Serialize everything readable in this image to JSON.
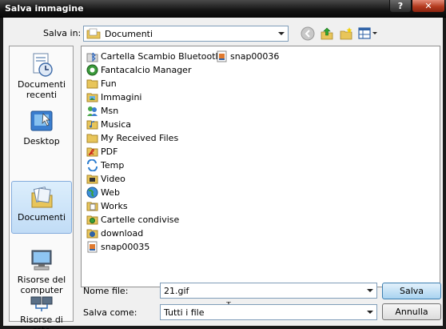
{
  "window": {
    "title": "Salva immagine",
    "help_label": "?",
    "close_label": "✕"
  },
  "toolbar": {
    "save_in_label": "Salva in:",
    "location": "Documenti",
    "tools": [
      "back-icon",
      "up-folder-icon",
      "new-folder-icon",
      "view-menu-icon"
    ]
  },
  "places": [
    {
      "label": "Documenti recenti",
      "icon": "recent-documents-icon"
    },
    {
      "label": "Desktop",
      "icon": "desktop-icon"
    },
    {
      "label": "Documenti",
      "icon": "documents-icon",
      "selected": true
    },
    {
      "label": "Risorse del computer",
      "icon": "computer-icon"
    },
    {
      "label": "Risorse di rete",
      "icon": "network-icon"
    }
  ],
  "files": [
    {
      "name": "Cartella Scambio Bluetooth",
      "icon": "bluetooth-folder-icon"
    },
    {
      "name": "Fantacalcio Manager",
      "icon": "app-folder-icon"
    },
    {
      "name": "Fun",
      "icon": "folder-icon"
    },
    {
      "name": "Immagini",
      "icon": "pictures-folder-icon"
    },
    {
      "name": "Msn",
      "icon": "msn-folder-icon"
    },
    {
      "name": "Musica",
      "icon": "music-folder-icon"
    },
    {
      "name": "My Received Files",
      "icon": "folder-icon"
    },
    {
      "name": "PDF",
      "icon": "pdf-folder-icon"
    },
    {
      "name": "Temp",
      "icon": "temp-folder-icon"
    },
    {
      "name": "Video",
      "icon": "video-folder-icon"
    },
    {
      "name": "Web",
      "icon": "web-folder-icon"
    },
    {
      "name": "Works",
      "icon": "works-folder-icon"
    },
    {
      "name": "Cartelle condivise",
      "icon": "shared-folder-icon"
    },
    {
      "name": "download",
      "icon": "download-folder-icon"
    },
    {
      "name": "snap00035",
      "icon": "image-file-icon"
    },
    {
      "name": "snap00036",
      "icon": "image-file-icon"
    }
  ],
  "form": {
    "filename_label": "Nome file:",
    "filename_value": "21.gif",
    "savetype_label": "Salva come:",
    "savetype_value": "Tutti i file",
    "save_button": "Salva",
    "cancel_button": "Annulla"
  },
  "colors": {
    "selection": "#c1dcf6",
    "titlebar": "#151515",
    "close": "#b33a1e"
  }
}
